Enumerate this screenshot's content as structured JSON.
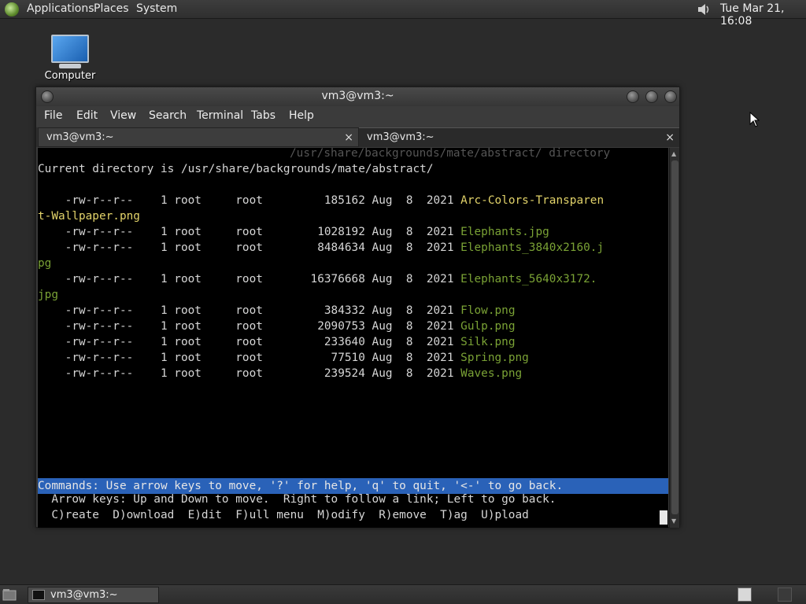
{
  "top_panel": {
    "menus": [
      "Applications",
      "Places",
      "System"
    ],
    "clock": "Tue Mar 21, 16:08",
    "icons": [
      "mate-logo-icon",
      "volume-icon"
    ]
  },
  "desktop": {
    "computer_label": "Computer"
  },
  "window": {
    "title": "vm3@vm3:~",
    "menu": [
      "File",
      "Edit",
      "View",
      "Search",
      "Terminal",
      "Tabs",
      "Help"
    ],
    "tabs": [
      {
        "label": "vm3@vm3:~",
        "close": "×"
      },
      {
        "label": "vm3@vm3:~",
        "close": "×"
      }
    ]
  },
  "terminal": {
    "top_dim": "/usr/share/backgrounds/mate/abstract/ directory",
    "current_dir": "Current directory is /usr/share/backgrounds/mate/abstract/",
    "files": [
      {
        "perm": "-rw-r--r--",
        "links": "1",
        "owner": "root",
        "group": "root",
        "size": "185162",
        "month": "Aug",
        "day": "8",
        "year": "2021",
        "name": "Arc-Colors-Transparen",
        "name2": "t-Wallpaper.png",
        "color": "yellow"
      },
      {
        "perm": "-rw-r--r--",
        "links": "1",
        "owner": "root",
        "group": "root",
        "size": "1028192",
        "month": "Aug",
        "day": "8",
        "year": "2021",
        "name": "Elephants.jpg",
        "name2": "",
        "color": "green"
      },
      {
        "perm": "-rw-r--r--",
        "links": "1",
        "owner": "root",
        "group": "root",
        "size": "8484634",
        "month": "Aug",
        "day": "8",
        "year": "2021",
        "name": "Elephants_3840x2160.j",
        "name2": "pg",
        "color": "green"
      },
      {
        "perm": "-rw-r--r--",
        "links": "1",
        "owner": "root",
        "group": "root",
        "size": "16376668",
        "month": "Aug",
        "day": "8",
        "year": "2021",
        "name": "Elephants_5640x3172.",
        "name2": "jpg",
        "color": "green"
      },
      {
        "perm": "-rw-r--r--",
        "links": "1",
        "owner": "root",
        "group": "root",
        "size": "384332",
        "month": "Aug",
        "day": "8",
        "year": "2021",
        "name": "Flow.png",
        "name2": "",
        "color": "green"
      },
      {
        "perm": "-rw-r--r--",
        "links": "1",
        "owner": "root",
        "group": "root",
        "size": "2090753",
        "month": "Aug",
        "day": "8",
        "year": "2021",
        "name": "Gulp.png",
        "name2": "",
        "color": "green"
      },
      {
        "perm": "-rw-r--r--",
        "links": "1",
        "owner": "root",
        "group": "root",
        "size": "233640",
        "month": "Aug",
        "day": "8",
        "year": "2021",
        "name": "Silk.png",
        "name2": "",
        "color": "green"
      },
      {
        "perm": "-rw-r--r--",
        "links": "1",
        "owner": "root",
        "group": "root",
        "size": "77510",
        "month": "Aug",
        "day": "8",
        "year": "2021",
        "name": "Spring.png",
        "name2": "",
        "color": "green"
      },
      {
        "perm": "-rw-r--r--",
        "links": "1",
        "owner": "root",
        "group": "root",
        "size": "239524",
        "month": "Aug",
        "day": "8",
        "year": "2021",
        "name": "Waves.png",
        "name2": "",
        "color": "green"
      }
    ],
    "commands": "Commands: Use arrow keys to move, '?' for help, 'q' to quit, '<-' to go back.",
    "arrow_help": "  Arrow keys: Up and Down to move.  Right to follow a link; Left to go back.",
    "shortcuts": "  C)reate  D)ownload  E)dit  F)ull menu  M)odify  R)emove  T)ag  U)pload"
  },
  "taskbar": {
    "item_label": "vm3@vm3:~"
  },
  "colors": {
    "file_yellow": "#e2d36a",
    "file_green": "#7aa235",
    "command_bar": "#2a62b8"
  }
}
